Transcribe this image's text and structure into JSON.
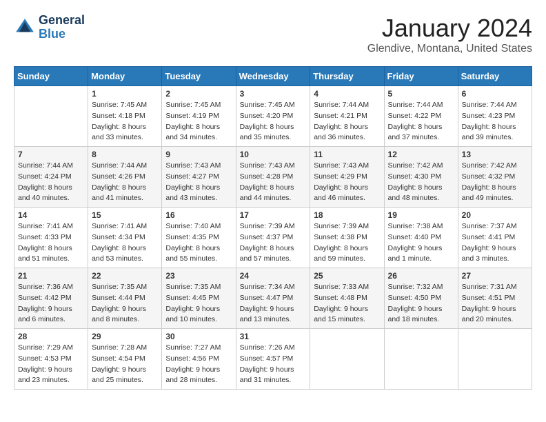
{
  "header": {
    "logo_line1": "General",
    "logo_line2": "Blue",
    "title": "January 2024",
    "subtitle": "Glendive, Montana, United States"
  },
  "weekdays": [
    "Sunday",
    "Monday",
    "Tuesday",
    "Wednesday",
    "Thursday",
    "Friday",
    "Saturday"
  ],
  "weeks": [
    [
      {
        "day": "",
        "sunrise": "",
        "sunset": "",
        "daylight": ""
      },
      {
        "day": "1",
        "sunrise": "Sunrise: 7:45 AM",
        "sunset": "Sunset: 4:18 PM",
        "daylight": "Daylight: 8 hours and 33 minutes."
      },
      {
        "day": "2",
        "sunrise": "Sunrise: 7:45 AM",
        "sunset": "Sunset: 4:19 PM",
        "daylight": "Daylight: 8 hours and 34 minutes."
      },
      {
        "day": "3",
        "sunrise": "Sunrise: 7:45 AM",
        "sunset": "Sunset: 4:20 PM",
        "daylight": "Daylight: 8 hours and 35 minutes."
      },
      {
        "day": "4",
        "sunrise": "Sunrise: 7:44 AM",
        "sunset": "Sunset: 4:21 PM",
        "daylight": "Daylight: 8 hours and 36 minutes."
      },
      {
        "day": "5",
        "sunrise": "Sunrise: 7:44 AM",
        "sunset": "Sunset: 4:22 PM",
        "daylight": "Daylight: 8 hours and 37 minutes."
      },
      {
        "day": "6",
        "sunrise": "Sunrise: 7:44 AM",
        "sunset": "Sunset: 4:23 PM",
        "daylight": "Daylight: 8 hours and 39 minutes."
      }
    ],
    [
      {
        "day": "7",
        "sunrise": "Sunrise: 7:44 AM",
        "sunset": "Sunset: 4:24 PM",
        "daylight": "Daylight: 8 hours and 40 minutes."
      },
      {
        "day": "8",
        "sunrise": "Sunrise: 7:44 AM",
        "sunset": "Sunset: 4:26 PM",
        "daylight": "Daylight: 8 hours and 41 minutes."
      },
      {
        "day": "9",
        "sunrise": "Sunrise: 7:43 AM",
        "sunset": "Sunset: 4:27 PM",
        "daylight": "Daylight: 8 hours and 43 minutes."
      },
      {
        "day": "10",
        "sunrise": "Sunrise: 7:43 AM",
        "sunset": "Sunset: 4:28 PM",
        "daylight": "Daylight: 8 hours and 44 minutes."
      },
      {
        "day": "11",
        "sunrise": "Sunrise: 7:43 AM",
        "sunset": "Sunset: 4:29 PM",
        "daylight": "Daylight: 8 hours and 46 minutes."
      },
      {
        "day": "12",
        "sunrise": "Sunrise: 7:42 AM",
        "sunset": "Sunset: 4:30 PM",
        "daylight": "Daylight: 8 hours and 48 minutes."
      },
      {
        "day": "13",
        "sunrise": "Sunrise: 7:42 AM",
        "sunset": "Sunset: 4:32 PM",
        "daylight": "Daylight: 8 hours and 49 minutes."
      }
    ],
    [
      {
        "day": "14",
        "sunrise": "Sunrise: 7:41 AM",
        "sunset": "Sunset: 4:33 PM",
        "daylight": "Daylight: 8 hours and 51 minutes."
      },
      {
        "day": "15",
        "sunrise": "Sunrise: 7:41 AM",
        "sunset": "Sunset: 4:34 PM",
        "daylight": "Daylight: 8 hours and 53 minutes."
      },
      {
        "day": "16",
        "sunrise": "Sunrise: 7:40 AM",
        "sunset": "Sunset: 4:35 PM",
        "daylight": "Daylight: 8 hours and 55 minutes."
      },
      {
        "day": "17",
        "sunrise": "Sunrise: 7:39 AM",
        "sunset": "Sunset: 4:37 PM",
        "daylight": "Daylight: 8 hours and 57 minutes."
      },
      {
        "day": "18",
        "sunrise": "Sunrise: 7:39 AM",
        "sunset": "Sunset: 4:38 PM",
        "daylight": "Daylight: 8 hours and 59 minutes."
      },
      {
        "day": "19",
        "sunrise": "Sunrise: 7:38 AM",
        "sunset": "Sunset: 4:40 PM",
        "daylight": "Daylight: 9 hours and 1 minute."
      },
      {
        "day": "20",
        "sunrise": "Sunrise: 7:37 AM",
        "sunset": "Sunset: 4:41 PM",
        "daylight": "Daylight: 9 hours and 3 minutes."
      }
    ],
    [
      {
        "day": "21",
        "sunrise": "Sunrise: 7:36 AM",
        "sunset": "Sunset: 4:42 PM",
        "daylight": "Daylight: 9 hours and 6 minutes."
      },
      {
        "day": "22",
        "sunrise": "Sunrise: 7:35 AM",
        "sunset": "Sunset: 4:44 PM",
        "daylight": "Daylight: 9 hours and 8 minutes."
      },
      {
        "day": "23",
        "sunrise": "Sunrise: 7:35 AM",
        "sunset": "Sunset: 4:45 PM",
        "daylight": "Daylight: 9 hours and 10 minutes."
      },
      {
        "day": "24",
        "sunrise": "Sunrise: 7:34 AM",
        "sunset": "Sunset: 4:47 PM",
        "daylight": "Daylight: 9 hours and 13 minutes."
      },
      {
        "day": "25",
        "sunrise": "Sunrise: 7:33 AM",
        "sunset": "Sunset: 4:48 PM",
        "daylight": "Daylight: 9 hours and 15 minutes."
      },
      {
        "day": "26",
        "sunrise": "Sunrise: 7:32 AM",
        "sunset": "Sunset: 4:50 PM",
        "daylight": "Daylight: 9 hours and 18 minutes."
      },
      {
        "day": "27",
        "sunrise": "Sunrise: 7:31 AM",
        "sunset": "Sunset: 4:51 PM",
        "daylight": "Daylight: 9 hours and 20 minutes."
      }
    ],
    [
      {
        "day": "28",
        "sunrise": "Sunrise: 7:29 AM",
        "sunset": "Sunset: 4:53 PM",
        "daylight": "Daylight: 9 hours and 23 minutes."
      },
      {
        "day": "29",
        "sunrise": "Sunrise: 7:28 AM",
        "sunset": "Sunset: 4:54 PM",
        "daylight": "Daylight: 9 hours and 25 minutes."
      },
      {
        "day": "30",
        "sunrise": "Sunrise: 7:27 AM",
        "sunset": "Sunset: 4:56 PM",
        "daylight": "Daylight: 9 hours and 28 minutes."
      },
      {
        "day": "31",
        "sunrise": "Sunrise: 7:26 AM",
        "sunset": "Sunset: 4:57 PM",
        "daylight": "Daylight: 9 hours and 31 minutes."
      },
      {
        "day": "",
        "sunrise": "",
        "sunset": "",
        "daylight": ""
      },
      {
        "day": "",
        "sunrise": "",
        "sunset": "",
        "daylight": ""
      },
      {
        "day": "",
        "sunrise": "",
        "sunset": "",
        "daylight": ""
      }
    ]
  ]
}
